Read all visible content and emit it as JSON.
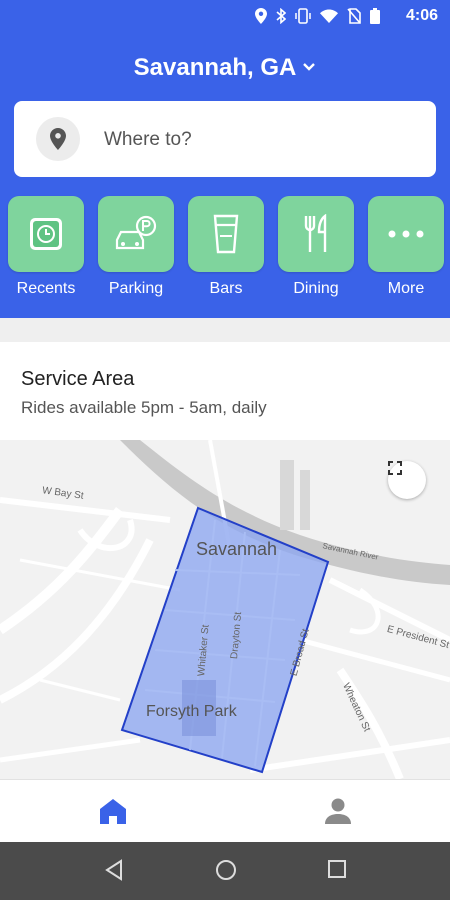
{
  "status_bar": {
    "time": "4:06",
    "icons": [
      "location-icon",
      "bluetooth-icon",
      "vibrate-icon",
      "wifi-icon",
      "no-sim-icon",
      "battery-icon"
    ]
  },
  "header": {
    "city": "Savannah, GA"
  },
  "search": {
    "placeholder": "Where to?"
  },
  "categories": [
    {
      "label": "Recents",
      "icon": "clock-icon"
    },
    {
      "label": "Parking",
      "icon": "car-parking-icon"
    },
    {
      "label": "Bars",
      "icon": "beer-glass-icon"
    },
    {
      "label": "Dining",
      "icon": "fork-knife-icon"
    },
    {
      "label": "More",
      "icon": "more-dots-icon"
    }
  ],
  "service_area": {
    "title": "Service Area",
    "subtitle": "Rides available 5pm - 5am, daily"
  },
  "map": {
    "labels": {
      "city": "Savannah",
      "park": "Forsyth Park",
      "river": "Savannah River",
      "w_bay": "W Bay St",
      "e_president": "E President St",
      "whitaker": "Whitaker St",
      "drayton": "Drayton St",
      "e_broad": "E Broad St",
      "wheaton": "Wheaton St"
    }
  },
  "bottom_nav": {
    "items": [
      "home-icon",
      "profile-icon"
    ]
  },
  "colors": {
    "brand": "#3a62e8",
    "category_tile": "#7fd49d",
    "service_area_fill": "#8fa8f0",
    "service_area_stroke": "#2340c8",
    "system_nav": "#4b4b4b"
  }
}
